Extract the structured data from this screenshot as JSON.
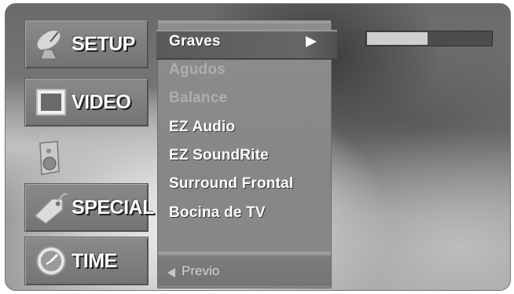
{
  "sidebar": {
    "items": [
      {
        "label": "SETUP",
        "icon": "satellite-dish-icon"
      },
      {
        "label": "VIDEO",
        "icon": "screen-icon"
      },
      {
        "label": "",
        "icon": "speaker-icon"
      },
      {
        "label": "SPECIAL",
        "icon": "tag-icon"
      },
      {
        "label": "TIME",
        "icon": "clock-icon"
      }
    ]
  },
  "submenu": {
    "items": [
      "Graves",
      "Agudos",
      "Balance",
      "EZ Audio",
      "EZ SoundRite",
      "Surround Frontal",
      "Bocina de TV"
    ],
    "selected": "Graves",
    "disabled": [
      "Agudos",
      "Balance"
    ]
  },
  "footer": {
    "back_label": "Previo"
  },
  "level_bar": {
    "value": 0.48
  },
  "colors": {
    "active_text": "#ffffff",
    "disabled_text": "#aeaeae"
  }
}
